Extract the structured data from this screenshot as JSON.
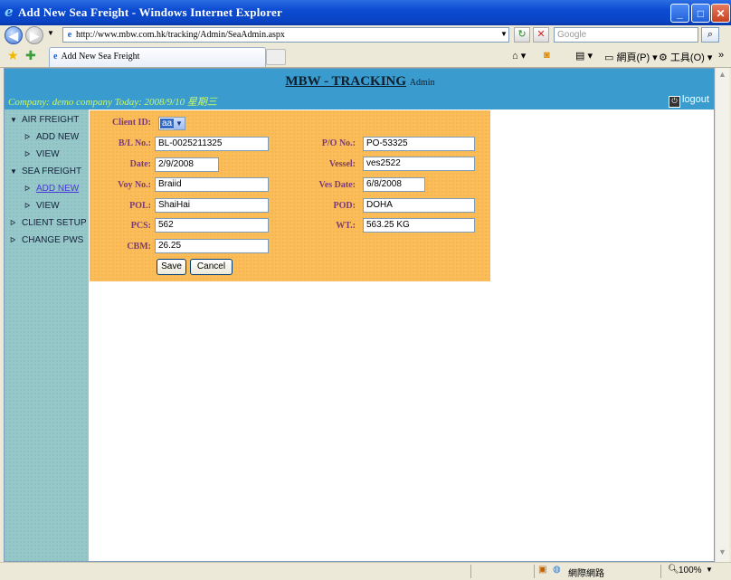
{
  "window": {
    "title": "Add New Sea Freight - Windows Internet Explorer",
    "controls": {
      "minimize": "_",
      "maximize": "□",
      "close": "✕"
    }
  },
  "addressbar": {
    "url": "http://www.mbw.com.hk/tracking/Admin/SeaAdmin.aspx",
    "search_placeholder": "Google"
  },
  "tab": {
    "title": "Add New Sea Freight"
  },
  "commands": {
    "page": "網頁(P)",
    "tools": "工具(O)"
  },
  "header": {
    "brand": "MBW - TRACKING",
    "role": "Admin",
    "info": "Company: demo company Today: 2008/9/10 星期三",
    "logout": "logout"
  },
  "sidebar": {
    "sections": [
      {
        "label": "AIR FREIGHT",
        "items": [
          "ADD NEW",
          "VIEW"
        ]
      },
      {
        "label": "SEA FREIGHT",
        "items": [
          "ADD NEW",
          "VIEW"
        ]
      },
      {
        "label": "CLIENT SETUP"
      },
      {
        "label": "CHANGE PWS"
      }
    ]
  },
  "form": {
    "client_id": {
      "label": "Client ID:",
      "value": "aa"
    },
    "bl_no": {
      "label": "B/L No.:",
      "value": "BL-0025211325"
    },
    "po_no": {
      "label": "P/O No.:",
      "value": "PO-53325"
    },
    "date": {
      "label": "Date:",
      "value": "2/9/2008"
    },
    "vessel": {
      "label": "Vessel:",
      "value": "ves2522"
    },
    "voy_no": {
      "label": "Voy No.:",
      "value": "Braiid"
    },
    "ves_date": {
      "label": "Ves Date:",
      "value": "6/8/2008"
    },
    "pol": {
      "label": "POL:",
      "value": "ShaiHai"
    },
    "pod": {
      "label": "POD:",
      "value": "DOHA"
    },
    "pcs": {
      "label": "PCS:",
      "value": "562"
    },
    "wt": {
      "label": "WT.:",
      "value": "563.25 KG"
    },
    "cbm": {
      "label": "CBM:",
      "value": "26.25"
    },
    "save": "Save",
    "cancel": "Cancel"
  },
  "statusbar": {
    "zone": "網際網路",
    "zoom": "100%"
  }
}
